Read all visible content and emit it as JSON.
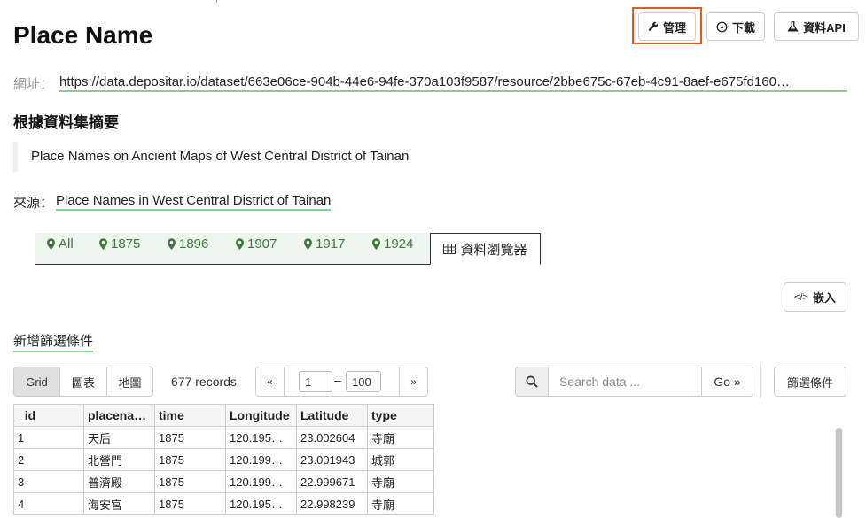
{
  "page": {
    "title": "Place Name"
  },
  "header_buttons": {
    "manage": "管理",
    "download": "下載",
    "api": "資料API"
  },
  "url": {
    "label": "網址：",
    "value": "https://data.depositar.io/dataset/663e06ce-904b-44e6-94fe-370a103f9587/resource/2bbe675c-67eb-4c91-8aef-e675fd160…"
  },
  "summary": {
    "heading": "根據資料集摘要",
    "text": "Place Names on Ancient Maps of West Central District of Tainan"
  },
  "source": {
    "label": "來源：",
    "link": "Place Names in West Central District of Tainan"
  },
  "tabs": [
    {
      "label": "All",
      "icon": "map-marker-icon"
    },
    {
      "label": "1875",
      "icon": "map-marker-icon"
    },
    {
      "label": "1896",
      "icon": "map-marker-icon"
    },
    {
      "label": "1907",
      "icon": "map-marker-icon"
    },
    {
      "label": "1917",
      "icon": "map-marker-icon"
    },
    {
      "label": "1924",
      "icon": "map-marker-icon"
    }
  ],
  "active_tab": {
    "label": "資料瀏覽器",
    "icon": "table-icon"
  },
  "embed": {
    "label": "嵌入"
  },
  "add_filter": "新增篩選條件",
  "view_buttons": [
    "Grid",
    "圖表",
    "地圖"
  ],
  "records": "677 records",
  "pager": {
    "prev": "«",
    "from": "1",
    "dash": "–",
    "to": "100",
    "next": "»"
  },
  "search": {
    "placeholder": "Search data ...",
    "go": "Go »"
  },
  "filter_button": "篩選條件",
  "table": {
    "columns": [
      "_id",
      "placena…",
      "time",
      "Longitude",
      "Latitude",
      "type"
    ],
    "rows": [
      [
        "1",
        "天后",
        "1875",
        "120.195…",
        "23.002604",
        "寺廟"
      ],
      [
        "2",
        "北營門",
        "1875",
        "120.199…",
        "23.001943",
        "城郭"
      ],
      [
        "3",
        "普濟殿",
        "1875",
        "120.199…",
        "22.999671",
        "寺廟"
      ],
      [
        "4",
        "海安宮",
        "1875",
        "120.195…",
        "22.998239",
        "寺廟"
      ]
    ]
  },
  "colors": {
    "accent_green": "#3b7a3b",
    "link_underline": "#7fd391",
    "highlight": "#e2592f"
  }
}
